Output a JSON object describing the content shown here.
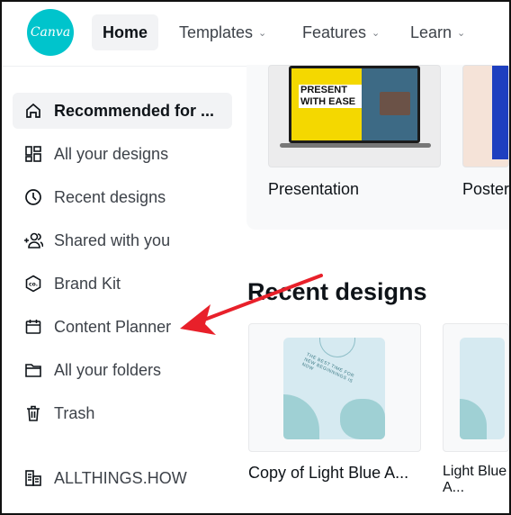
{
  "header": {
    "logo": "Canva",
    "nav": [
      {
        "label": "Home",
        "active": true
      },
      {
        "label": "Templates",
        "has_dropdown": true
      },
      {
        "label": "Features",
        "has_dropdown": true
      },
      {
        "label": "Learn",
        "has_dropdown": true
      }
    ]
  },
  "sidebar": {
    "items": [
      {
        "label": "Recommended for ...",
        "icon": "home-icon",
        "active": true
      },
      {
        "label": "All your designs",
        "icon": "grid-icon"
      },
      {
        "label": "Recent designs",
        "icon": "clock-icon"
      },
      {
        "label": "Shared with you",
        "icon": "shared-users-icon"
      },
      {
        "label": "Brand Kit",
        "icon": "brand-kit-icon"
      },
      {
        "label": "Content Planner",
        "icon": "calendar-icon"
      },
      {
        "label": "All your folders",
        "icon": "folder-icon"
      },
      {
        "label": "Trash",
        "icon": "trash-icon"
      }
    ],
    "team": {
      "label": "ALLTHINGS.HOW",
      "icon": "building-icon"
    }
  },
  "design_types": [
    {
      "label": "Presentation",
      "thumb_text": "PRESENT WITH EASE"
    },
    {
      "label": "Poster"
    }
  ],
  "recent": {
    "title": "Recent designs",
    "items": [
      {
        "label": "Copy of Light Blue A..."
      },
      {
        "label": "Light Blue A..."
      }
    ],
    "art_text": "THE BEST TIME FOR NEW BEGINNINGS IS NOW"
  },
  "colors": {
    "brand": "#00c4cc",
    "annotation_arrow": "#e8202a"
  }
}
